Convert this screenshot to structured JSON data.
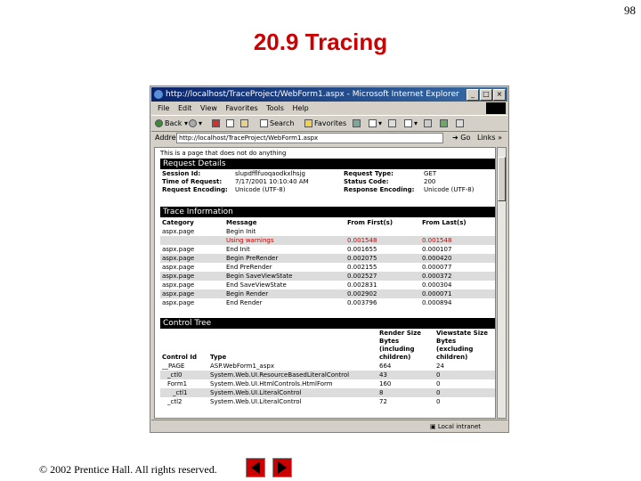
{
  "page_number": "98",
  "slide_title": "20.9 Tracing",
  "footer": "© 2002 Prentice Hall. All rights reserved.",
  "browser": {
    "title": "http://localhost/TraceProject/WebForm1.aspx - Microsoft Internet Explorer",
    "window_buttons": [
      "_",
      "□",
      "×"
    ],
    "menu": [
      "File",
      "Edit",
      "View",
      "Favorites",
      "Tools",
      "Help"
    ],
    "toolbar": {
      "back": "Back",
      "search": "Search",
      "favorites": "Favorites"
    },
    "address_label": "Address",
    "address_value": "http://localhost/TraceProject/WebForm1.aspx",
    "go_label": "Go",
    "links_label": "Links",
    "status_zone": "Local intranet"
  },
  "content": {
    "intro": "This is a page that does not do anything",
    "request_details": {
      "heading": "Request Details",
      "left": [
        {
          "label": "Session Id:",
          "value": "slupdfflfuoqaodkxlhsjg"
        },
        {
          "label": "Time of Request:",
          "value": "7/17/2001 10:10:40 AM"
        },
        {
          "label": "Request Encoding:",
          "value": "Unicode (UTF-8)"
        }
      ],
      "right": [
        {
          "label": "Request Type:",
          "value": "GET"
        },
        {
          "label": "Status Code:",
          "value": "200"
        },
        {
          "label": "Response Encoding:",
          "value": "Unicode (UTF-8)"
        }
      ]
    },
    "trace_information": {
      "heading": "Trace Information",
      "columns": [
        "Category",
        "Message",
        "From First(s)",
        "From Last(s)"
      ],
      "rows": [
        {
          "category": "aspx.page",
          "message": "Begin Init",
          "from_first": "",
          "from_last": "",
          "warning": false
        },
        {
          "category": "",
          "message": "Using warnings",
          "from_first": "0.001548",
          "from_last": "0.001548",
          "warning": true
        },
        {
          "category": "aspx.page",
          "message": "End Init",
          "from_first": "0.001655",
          "from_last": "0.000107",
          "warning": false
        },
        {
          "category": "aspx.page",
          "message": "Begin PreRender",
          "from_first": "0.002075",
          "from_last": "0.000420",
          "warning": false
        },
        {
          "category": "aspx.page",
          "message": "End PreRender",
          "from_first": "0.002155",
          "from_last": "0.000077",
          "warning": false
        },
        {
          "category": "aspx.page",
          "message": "Begin SaveViewState",
          "from_first": "0.002527",
          "from_last": "0.000372",
          "warning": false
        },
        {
          "category": "aspx.page",
          "message": "End SaveViewState",
          "from_first": "0.002831",
          "from_last": "0.000304",
          "warning": false
        },
        {
          "category": "aspx.page",
          "message": "Begin Render",
          "from_first": "0.002902",
          "from_last": "0.000071",
          "warning": false
        },
        {
          "category": "aspx.page",
          "message": "End Render",
          "from_first": "0.003796",
          "from_last": "0.000894",
          "warning": false
        }
      ]
    },
    "control_tree": {
      "heading": "Control Tree",
      "columns": [
        "Control Id",
        "Type",
        "Render Size Bytes (including children)",
        "Viewstate Size Bytes (excluding children)"
      ],
      "rows": [
        {
          "id": "__PAGE",
          "type": "ASP.WebForm1_aspx",
          "render": "664",
          "viewstate": "24"
        },
        {
          "id": "_ctl0",
          "type": "System.Web.UI.ResourceBasedLiteralControl",
          "render": "43",
          "viewstate": "0"
        },
        {
          "id": "Form1",
          "type": "System.Web.UI.HtmlControls.HtmlForm",
          "render": "160",
          "viewstate": "0"
        },
        {
          "id": "_ctl1",
          "type": "System.Web.UI.LiteralControl",
          "render": "8",
          "viewstate": "0"
        },
        {
          "id": "_ctl2",
          "type": "System.Web.UI.LiteralControl",
          "render": "72",
          "viewstate": "0"
        }
      ]
    }
  }
}
